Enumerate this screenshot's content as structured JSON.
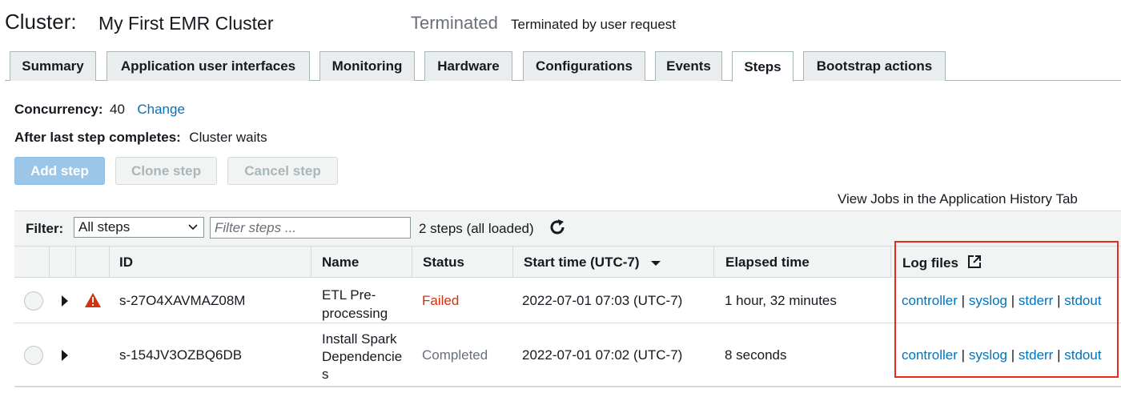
{
  "header": {
    "cluster_label": "Cluster:",
    "cluster_name": "My First EMR Cluster",
    "status": "Terminated",
    "status_reason": "Terminated by user request"
  },
  "tabs": [
    {
      "label": "Summary",
      "active": false
    },
    {
      "label": "Application user interfaces",
      "active": false
    },
    {
      "label": "Monitoring",
      "active": false
    },
    {
      "label": "Hardware",
      "active": false
    },
    {
      "label": "Configurations",
      "active": false
    },
    {
      "label": "Events",
      "active": false
    },
    {
      "label": "Steps",
      "active": true
    },
    {
      "label": "Bootstrap actions",
      "active": false
    }
  ],
  "info": {
    "concurrency_label": "Concurrency:",
    "concurrency_value": "40",
    "change_link": "Change",
    "after_label": "After last step completes:",
    "after_value": "Cluster waits"
  },
  "buttons": {
    "add_step": "Add step",
    "clone_step": "Clone step",
    "cancel_step": "Cancel step"
  },
  "history_link": "View Jobs in the Application History Tab",
  "filter": {
    "label": "Filter:",
    "selected": "All steps",
    "placeholder": "Filter steps ...",
    "loaded_count": "2 steps (all loaded)"
  },
  "table": {
    "columns": {
      "id": "ID",
      "name": "Name",
      "status": "Status",
      "start_time": "Start time (UTC-7)",
      "elapsed": "Elapsed time",
      "log_files": "Log files"
    },
    "rows": [
      {
        "id": "s-27O4XAVMAZ08M",
        "name_line1": "ETL Pre-",
        "name_line2": "processing",
        "name_line3": "",
        "status": "Failed",
        "start_time": "2022-07-01 07:03 (UTC-7)",
        "elapsed": "1 hour, 32 minutes",
        "warning": true
      },
      {
        "id": "s-154JV3OZBQ6DB",
        "name_line1": "Install Spark",
        "name_line2": "Dependencie",
        "name_line3": "s",
        "status": "Completed",
        "start_time": "2022-07-01 07:02 (UTC-7)",
        "elapsed": "8 seconds",
        "warning": false
      }
    ],
    "log_links": {
      "controller": "controller",
      "syslog": "syslog",
      "stderr": "stderr",
      "stdout": "stdout",
      "separator": "|"
    }
  },
  "colors": {
    "link": "#0073bb",
    "failed": "#d13212",
    "highlight": "#e62b1e",
    "primary_button": "#9cc6e8"
  },
  "icons": {
    "refresh": "refresh-icon",
    "warning": "warning-triangle-icon",
    "external": "external-link-icon",
    "sort": "sort-descending-icon"
  }
}
